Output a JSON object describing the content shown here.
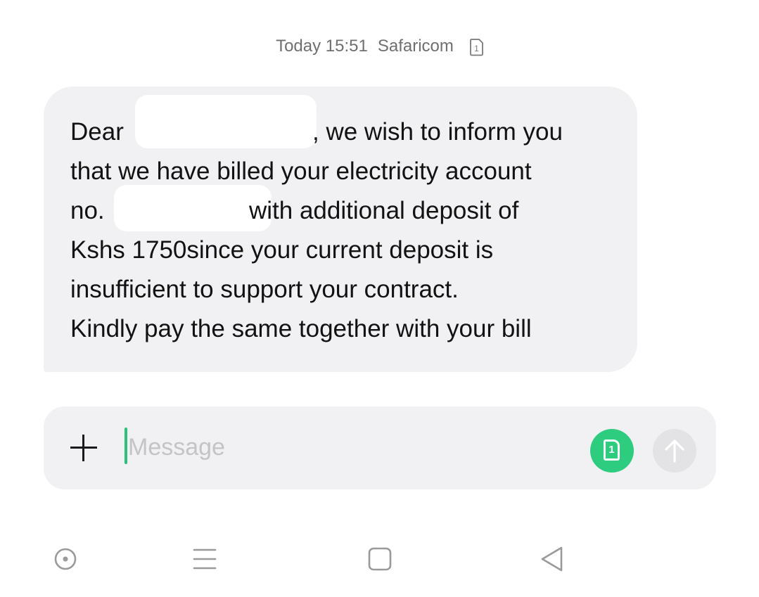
{
  "header": {
    "timestamp": "Today 15:51",
    "sender": "Safaricom",
    "sim_badge": "1"
  },
  "message": {
    "lines": [
      "Dear",
      ", we wish to inform you",
      "that we have billed your electricity account",
      "no.",
      "with additional deposit of",
      "Kshs 1750since your current deposit is",
      "insufficient to support your contract.",
      "Kindly pay the same together with your bill"
    ]
  },
  "composer": {
    "placeholder": "Message",
    "value": "",
    "sim_badge": "1"
  },
  "navbar": {
    "items": [
      "home-circle-icon",
      "menu-lines-icon",
      "square-icon",
      "back-triangle-icon"
    ]
  },
  "colors": {
    "accent": "#2ecc7f",
    "bubble": "#f1f1f3",
    "caret": "#2bc179"
  }
}
